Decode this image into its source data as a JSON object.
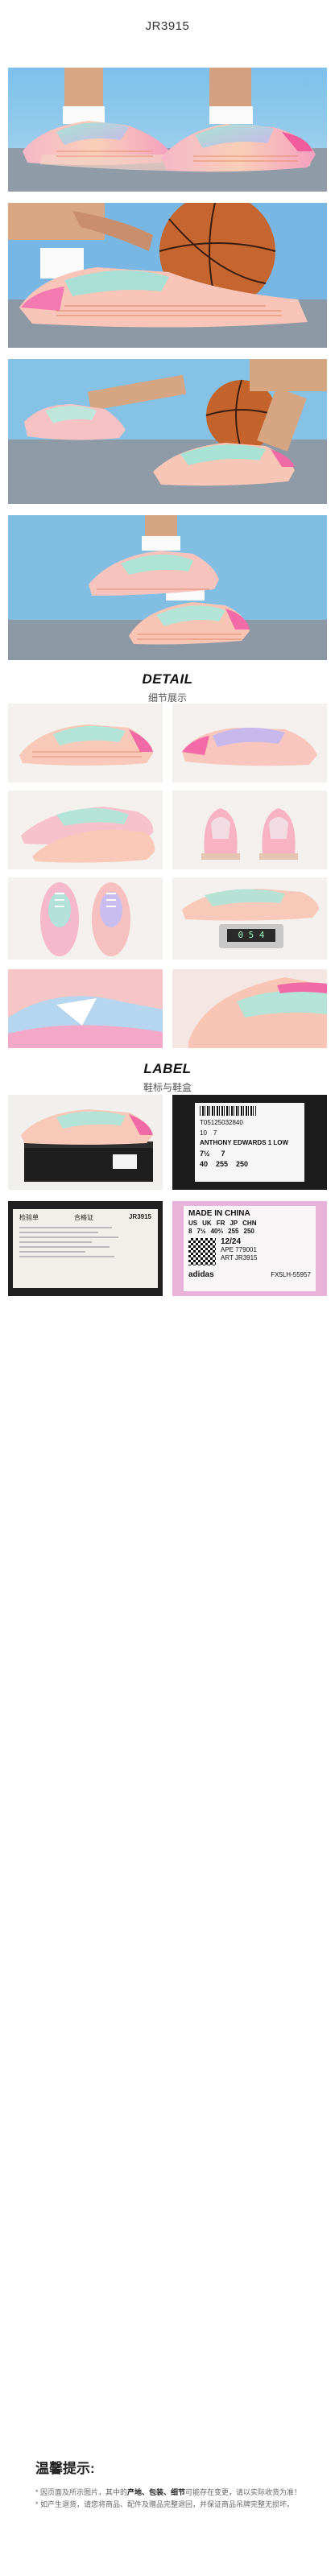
{
  "product_code": "JR3915",
  "detail_section": {
    "title_en": "DETAIL",
    "title_cn": "细节展示"
  },
  "label_section": {
    "title_en": "LABEL",
    "title_cn": "鞋标与鞋盒"
  },
  "scale_readout": "0 5 4",
  "tongue_label": {
    "code": "T05125032840",
    "size_row": [
      "10",
      "7",
      ""
    ],
    "name": "ANTHONY EDWARDS 1 LOW",
    "sizes_head": [
      "7½",
      "7"
    ],
    "sizes_foot": [
      "40",
      "255",
      "250"
    ]
  },
  "cert_card": {
    "title": "检验单",
    "status": "合格证",
    "code": "JR3915"
  },
  "inner_label": {
    "line1": "MADE IN CHINA",
    "head": [
      "US",
      "UK",
      "FR",
      "JP",
      "CHN"
    ],
    "row": [
      "8",
      "7½",
      "40⅔",
      "255",
      "250"
    ],
    "date": "12/24",
    "ape": "APE 779001",
    "art": "ART JR3915",
    "brand": "adidas",
    "tail": "FX5LH-55957"
  },
  "notice": {
    "title": "温馨提示:",
    "line1_pre": "* 因页面及所示图片，其中的",
    "line1_bold": "产地、包装、细节",
    "line1_post": "可能存在变更，请以实际收货为准！",
    "line2": "* 如产生退货，请您将商品、配件及赠品完整退回，并保证商品吊牌完整无损坏。"
  },
  "colors": {
    "accent": "#e65a9c",
    "sky": "#8fc4e6",
    "court": "#8b9aa6"
  }
}
